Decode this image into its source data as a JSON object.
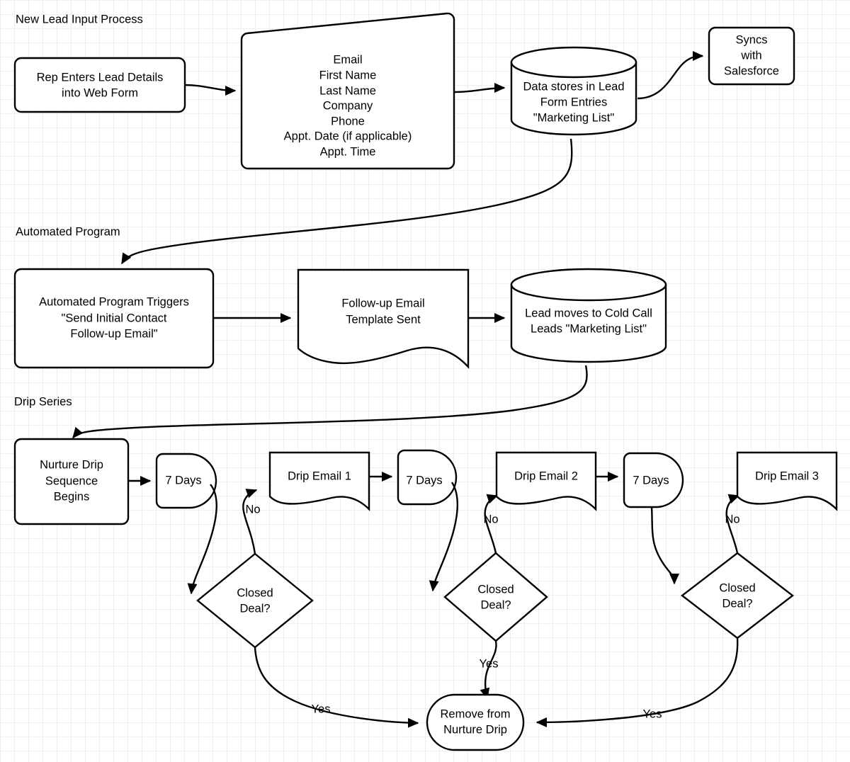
{
  "diagram": {
    "title_visible": false,
    "background": "#ffffff",
    "grid_color": "#e6e6e6",
    "stroke_color": "#000000",
    "fill_color": "#ffffff",
    "sections": [
      {
        "id": "sec1",
        "label": "New Lead Input Process"
      },
      {
        "id": "sec2",
        "label": "Automated Program"
      },
      {
        "id": "sec3",
        "label": "Drip Series"
      }
    ],
    "nodes": [
      {
        "id": "n1",
        "shape": "process",
        "label": "Rep Enters Lead Details\ninto Web Form",
        "lines": [
          "Rep Enters Lead Details",
          "into Web Form"
        ]
      },
      {
        "id": "n2",
        "shape": "card-skewed",
        "label": "Email First Name Last Name Company Phone Appt. Date (if applicable) Appt. Time",
        "lines": [
          "Email",
          "First Name",
          "Last Name",
          "Company",
          "Phone",
          "Appt. Date (if applicable)",
          "Appt. Time"
        ]
      },
      {
        "id": "n3",
        "shape": "database",
        "label": "Data stores in Lead Form Entries \"Marketing List\"",
        "lines": [
          "Data stores in Lead",
          "Form Entries",
          "\"Marketing List\""
        ]
      },
      {
        "id": "n4",
        "shape": "process",
        "label": "Syncs with Salesforce",
        "lines": [
          "Syncs",
          "with",
          "Salesforce"
        ]
      },
      {
        "id": "n5",
        "shape": "process",
        "label": "Automated Program Triggers \"Send Initial Contact Follow-up Email\"",
        "lines": [
          "Automated Program Triggers",
          "\"Send Initial Contact",
          "Follow-up Email\""
        ]
      },
      {
        "id": "n6",
        "shape": "document",
        "label": "Follow-up Email Template Sent",
        "lines": [
          "Follow-up Email",
          "Template Sent"
        ]
      },
      {
        "id": "n7",
        "shape": "database",
        "label": "Lead moves to Cold Call Leads \"Marketing List\"",
        "lines": [
          "Lead moves to Cold Call",
          "Leads \"Marketing List\""
        ]
      },
      {
        "id": "n8",
        "shape": "process",
        "label": "Nurture Drip Sequence Begins",
        "lines": [
          "Nurture Drip",
          "Sequence",
          "Begins"
        ]
      },
      {
        "id": "n9",
        "shape": "delay",
        "label": "7 Days",
        "lines": [
          "7 Days"
        ]
      },
      {
        "id": "n10",
        "shape": "document",
        "label": "Drip Email 1",
        "lines": [
          "Drip Email 1"
        ]
      },
      {
        "id": "n11",
        "shape": "delay",
        "label": "7 Days",
        "lines": [
          "7 Days"
        ]
      },
      {
        "id": "n12",
        "shape": "document",
        "label": "Drip Email 2",
        "lines": [
          "Drip Email 2"
        ]
      },
      {
        "id": "n13",
        "shape": "delay",
        "label": "7 Days",
        "lines": [
          "7 Days"
        ]
      },
      {
        "id": "n14",
        "shape": "document",
        "label": "Drip Email 3",
        "lines": [
          "Drip Email 3"
        ]
      },
      {
        "id": "n15",
        "shape": "decision",
        "label": "Closed Deal?",
        "lines": [
          "Closed",
          "Deal?"
        ]
      },
      {
        "id": "n16",
        "shape": "decision",
        "label": "Closed Deal?",
        "lines": [
          "Closed",
          "Deal?"
        ]
      },
      {
        "id": "n17",
        "shape": "decision",
        "label": "Closed Deal?",
        "lines": [
          "Closed",
          "Deal?"
        ]
      },
      {
        "id": "n18",
        "shape": "terminal",
        "label": "Remove from Nurture Drip",
        "lines": [
          "Remove from",
          "Nurture Drip"
        ]
      }
    ],
    "edges": [
      {
        "from": "n1",
        "to": "n2",
        "label": ""
      },
      {
        "from": "n2",
        "to": "n3",
        "label": ""
      },
      {
        "from": "n3",
        "to": "n4",
        "label": ""
      },
      {
        "from": "n3",
        "to": "n5",
        "label": ""
      },
      {
        "from": "n5",
        "to": "n6",
        "label": ""
      },
      {
        "from": "n6",
        "to": "n7",
        "label": ""
      },
      {
        "from": "n7",
        "to": "n8",
        "label": ""
      },
      {
        "from": "n8",
        "to": "n9",
        "label": ""
      },
      {
        "from": "n9",
        "to": "n15",
        "label": ""
      },
      {
        "from": "n15",
        "to": "n10",
        "label": "No"
      },
      {
        "from": "n10",
        "to": "n11",
        "label": ""
      },
      {
        "from": "n11",
        "to": "n16",
        "label": ""
      },
      {
        "from": "n16",
        "to": "n12",
        "label": "No"
      },
      {
        "from": "n12",
        "to": "n13",
        "label": ""
      },
      {
        "from": "n13",
        "to": "n17",
        "label": ""
      },
      {
        "from": "n17",
        "to": "n14",
        "label": "No"
      },
      {
        "from": "n15",
        "to": "n18",
        "label": "Yes"
      },
      {
        "from": "n16",
        "to": "n18",
        "label": "Yes"
      },
      {
        "from": "n17",
        "to": "n18",
        "label": "Yes"
      }
    ],
    "edge_labels": {
      "no1": "No",
      "no2": "No",
      "no3": "No",
      "yes1": "Yes",
      "yes2": "Yes",
      "yes3": "Yes"
    }
  }
}
